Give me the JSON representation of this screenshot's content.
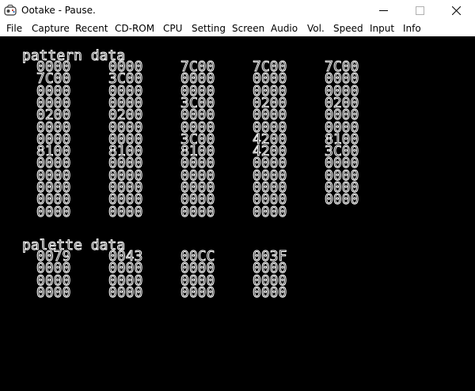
{
  "window": {
    "title": "Ootake - Pause.",
    "icon": "ootake-app-icon",
    "controls": [
      "minimize-icon",
      "maximize-icon",
      "close-icon"
    ]
  },
  "menu": {
    "items": [
      "File",
      "Capture",
      "Recent",
      "CD-ROM",
      "CPU",
      "Setting",
      "Screen",
      "Audio",
      "Vol.",
      "Speed",
      "Input",
      "Info"
    ]
  },
  "vram": {
    "pattern_heading": "pattern data",
    "pattern_rows": [
      [
        "0000",
        "0000",
        "7C00",
        "7C00",
        "7C00"
      ],
      [
        "7C00",
        "3C00",
        "0000",
        "0000",
        "0000"
      ],
      [
        "0000",
        "0000",
        "0000",
        "0000",
        "0000"
      ],
      [
        "0000",
        "0000",
        "3C00",
        "0200",
        "0200"
      ],
      [
        "0200",
        "0200",
        "0000",
        "0000",
        "0000"
      ],
      [
        "0000",
        "0000",
        "0000",
        "0000",
        "0000"
      ],
      [
        "0000",
        "0000",
        "3C00",
        "4200",
        "8100"
      ],
      [
        "8100",
        "8100",
        "8100",
        "4200",
        "3C00"
      ],
      [
        "0000",
        "0000",
        "0000",
        "0000",
        "0000"
      ],
      [
        "0000",
        "0000",
        "0000",
        "0000",
        "0000"
      ],
      [
        "0000",
        "0000",
        "0000",
        "0000",
        "0000"
      ],
      [
        "0000",
        "0000",
        "0000",
        "0000",
        "0000"
      ],
      [
        "0000",
        "0000",
        "0000",
        "0000"
      ]
    ],
    "palette_heading": "palette data",
    "palette_rows": [
      [
        "0079",
        "0043",
        "00CC",
        "003F"
      ],
      [
        "0000",
        "0000",
        "0000",
        "0000"
      ],
      [
        "0000",
        "0000",
        "0000",
        "0000"
      ],
      [
        "0000",
        "0000",
        "0000",
        "0000"
      ]
    ]
  },
  "colors": {
    "screen_background": "#000000",
    "text_outline": "#ffffff",
    "text_fill": "#000000",
    "window_background": "#ffffff"
  }
}
